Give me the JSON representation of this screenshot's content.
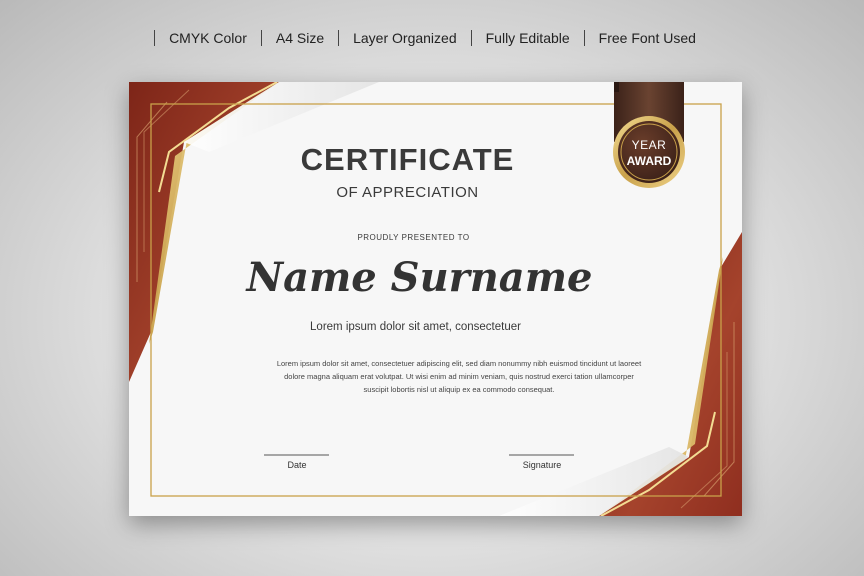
{
  "features": [
    "CMYK Color",
    "A4 Size",
    "Layer Organized",
    "Fully Editable",
    "Free Font Used"
  ],
  "certificate": {
    "title": "CERTIFICATE",
    "subtitle": "OF APPRECIATION",
    "presented": "PROUDLY PRESENTED TO",
    "name": "Name Surname",
    "lorem_short": "Lorem ipsum dolor sit amet, consectetuer",
    "paragraph_lines": [
      "Lorem ipsum dolor sit amet, consectetuer adipiscing elit, sed diam nonummy nibh euismod tincidunt ut laoreet",
      "dolore magna aliquam erat volutpat. Ut wisi enim ad minim veniam, quis nostrud exerci tation ullamcorper",
      "suscipit lobortis nisl ut aliquip ex ea commodo consequat."
    ],
    "date_label": "Date",
    "signature_label": "Signature",
    "badge": {
      "line1": "YEAR",
      "line2": "AWARD"
    }
  },
  "colors": {
    "maroon": "#8f2e1f",
    "gold": "#c9a14a",
    "badge_brown": "#4a2c20"
  }
}
